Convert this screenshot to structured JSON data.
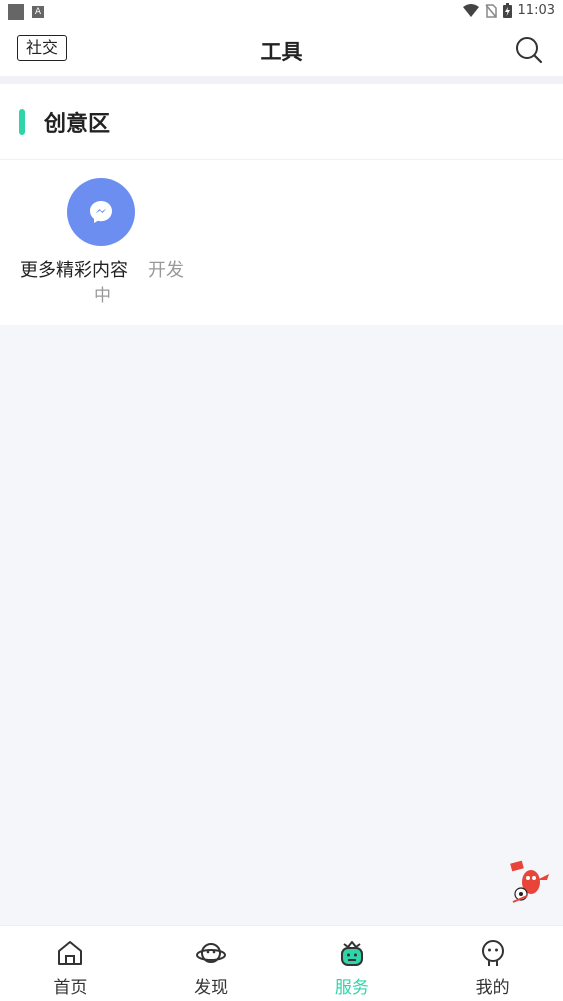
{
  "status_bar": {
    "time": "11:03"
  },
  "header": {
    "social_tag": "社交",
    "title": "工具",
    "search_icon": "search-icon"
  },
  "section": {
    "title": "创意区",
    "accent_color": "#2fd4a8",
    "items": [
      {
        "label": "更多精彩内容",
        "status_part1": "开发",
        "status_part2": "中",
        "icon": "messenger-icon",
        "icon_bg": "#6b8ef0"
      }
    ]
  },
  "tabbar": {
    "active_color": "#2fd4a8",
    "tabs": [
      {
        "label": "首页",
        "icon": "home-icon",
        "active": false
      },
      {
        "label": "发现",
        "icon": "planet-icon",
        "active": false
      },
      {
        "label": "服务",
        "icon": "robot-icon",
        "active": true
      },
      {
        "label": "我的",
        "icon": "profile-icon",
        "active": false
      }
    ]
  }
}
